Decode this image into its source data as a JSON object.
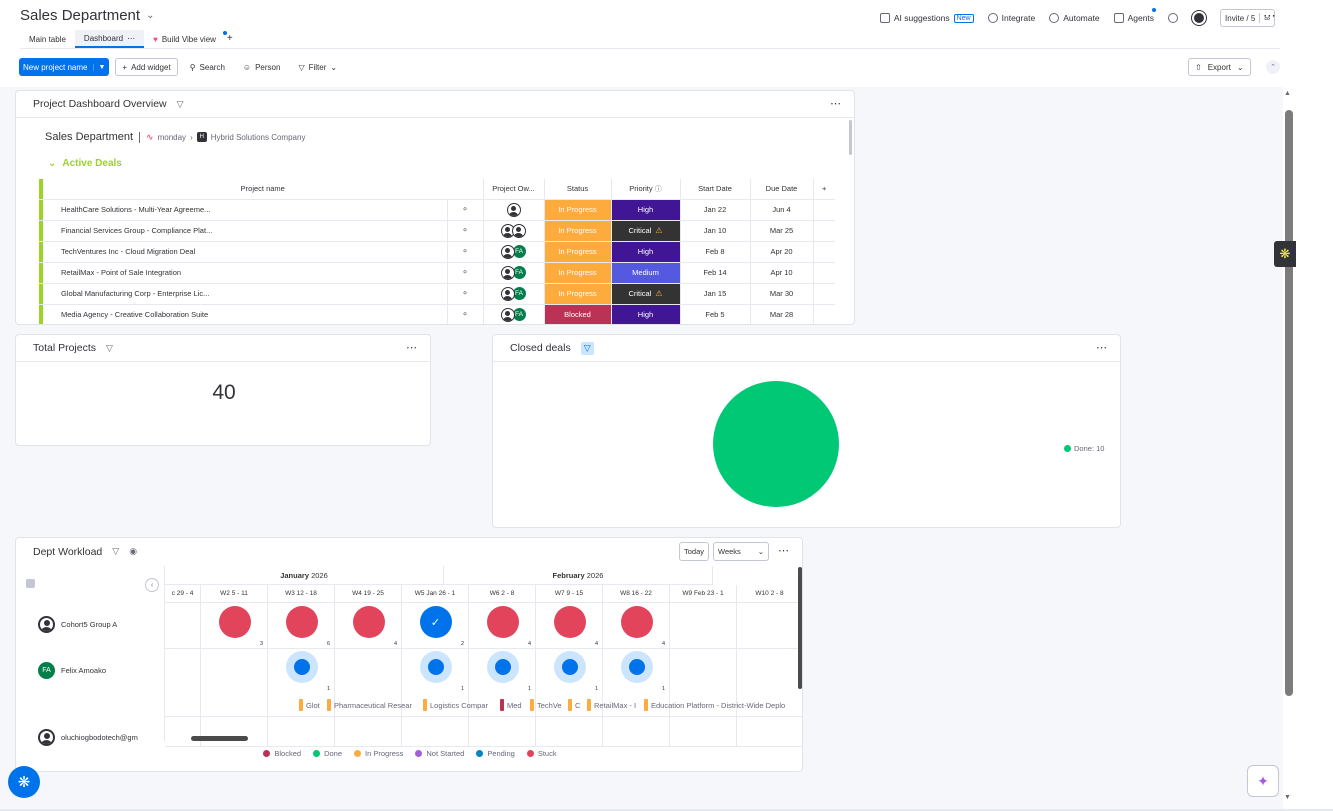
{
  "header": {
    "board_title": "Sales Department",
    "ai_suggestions": "AI suggestions",
    "new_badge": "New",
    "integrate": "Integrate",
    "automate": "Automate",
    "agents": "Agents",
    "invite": "Invite / 5"
  },
  "tabs": [
    {
      "label": "Main table"
    },
    {
      "label": "Dashboard"
    },
    {
      "label": "Build Vibe view"
    }
  ],
  "toolbar": {
    "new_project": "New project name",
    "add_widget": "Add widget",
    "search": "Search",
    "person": "Person",
    "filter": "Filter",
    "export": "Export"
  },
  "overview": {
    "title": "Project Dashboard Overview",
    "board_name": "Sales Department",
    "workspace_app": "monday",
    "workspace_company": "Hybrid Solutions Company",
    "group_title": "Active Deals",
    "columns": [
      "Project name",
      "Project Ow...",
      "Status",
      "Priority",
      "Start Date",
      "Due Date"
    ],
    "rows": [
      {
        "name": "HealthCare Solutions - Multi-Year Agreeme...",
        "owners": [
          "user"
        ],
        "status": "In Progress",
        "priority": "High",
        "start": "Jan 22",
        "due": "Jun 4"
      },
      {
        "name": "Financial Services Group - Compliance Plat...",
        "owners": [
          "user",
          "user"
        ],
        "status": "In Progress",
        "priority": "Critical",
        "start": "Jan 10",
        "due": "Mar 25"
      },
      {
        "name": "TechVentures Inc - Cloud Migration Deal",
        "owners": [
          "user",
          "FA"
        ],
        "status": "In Progress",
        "priority": "High",
        "start": "Feb 8",
        "due": "Apr 20"
      },
      {
        "name": "RetailMax - Point of Sale Integration",
        "owners": [
          "user",
          "FA"
        ],
        "status": "In Progress",
        "priority": "Medium",
        "start": "Feb 14",
        "due": "Apr 10"
      },
      {
        "name": "Global Manufacturing Corp - Enterprise Lic...",
        "owners": [
          "user",
          "FA"
        ],
        "status": "In Progress",
        "priority": "Critical",
        "start": "Jan 15",
        "due": "Mar 30"
      },
      {
        "name": "Media Agency - Creative Collaboration Suite",
        "owners": [
          "user",
          "FA"
        ],
        "status": "Blocked",
        "priority": "High",
        "start": "Feb 5",
        "due": "Mar 28"
      }
    ],
    "status_colors": {
      "In Progress": "#fdab3d",
      "Blocked": "#bb3354"
    },
    "priority_colors": {
      "High": "#401694",
      "Critical": "#333333",
      "Medium": "#5559df"
    }
  },
  "total_projects": {
    "title": "Total Projects",
    "value": "40"
  },
  "closed_deals": {
    "title": "Closed deals",
    "legend_label": "Done: 10",
    "color": "#00c875"
  },
  "chart_data": {
    "type": "pie",
    "categories": [
      "Done"
    ],
    "values": [
      10
    ],
    "colors": [
      "#00c875"
    ]
  },
  "workload": {
    "title": "Dept Workload",
    "today": "Today",
    "weeks": "Weeks",
    "months": [
      {
        "label": "January",
        "year": "2026"
      },
      {
        "label": "February",
        "year": "2026"
      }
    ],
    "week_labels": [
      "c 29 - 4",
      "W2 5 - 11",
      "W3 12 - 18",
      "W4 19 - 25",
      "W5 Jan 26 - 1",
      "W6 2 - 8",
      "W7 9 - 15",
      "W8 16 - 22",
      "W9 Feb 23 - 1",
      "W10 2 - 8"
    ],
    "rows": [
      {
        "name": "Cohort5 Group A",
        "avatar": "user"
      },
      {
        "name": "Felix Amoako",
        "avatar": "FA"
      },
      {
        "name": "oluchiogbodotech@gm",
        "avatar": "user"
      }
    ],
    "row1_cells": [
      {
        "type": "red",
        "count": "3"
      },
      {
        "type": "red",
        "count": "6"
      },
      {
        "type": "red",
        "count": "4"
      },
      {
        "type": "check",
        "count": "2"
      },
      {
        "type": "red",
        "count": "4"
      },
      {
        "type": "red",
        "count": "4"
      },
      {
        "type": "red",
        "count": "4"
      }
    ],
    "row2_cells": [
      {
        "week": 2,
        "count": "1"
      },
      {
        "week": 4,
        "count": "1"
      },
      {
        "week": 5,
        "count": "1"
      },
      {
        "week": 6,
        "count": "1"
      },
      {
        "week": 7,
        "count": "1"
      }
    ],
    "tasks": [
      {
        "label": "Glot",
        "color": "#fdab3d"
      },
      {
        "label": "Pharmaceutical Resear",
        "color": "#fdab3d"
      },
      {
        "label": "Logistics Compar",
        "color": "#fdab3d"
      },
      {
        "label": "Med",
        "color": "#bb3354"
      },
      {
        "label": "TechVe",
        "color": "#fdab3d"
      },
      {
        "label": "C",
        "color": "#fdab3d"
      },
      {
        "label": "RetailMax - I",
        "color": "#fdab3d"
      },
      {
        "label": "Education Platform - District-Wide Deplo",
        "color": "#fdab3d"
      }
    ],
    "legend": [
      {
        "label": "Blocked",
        "color": "#bb3354"
      },
      {
        "label": "Done",
        "color": "#00c875"
      },
      {
        "label": "In Progress",
        "color": "#fdab3d"
      },
      {
        "label": "Not Started",
        "color": "#a25ddc"
      },
      {
        "label": "Pending",
        "color": "#0086c0"
      },
      {
        "label": "Stuck",
        "color": "#e2445c"
      }
    ]
  }
}
